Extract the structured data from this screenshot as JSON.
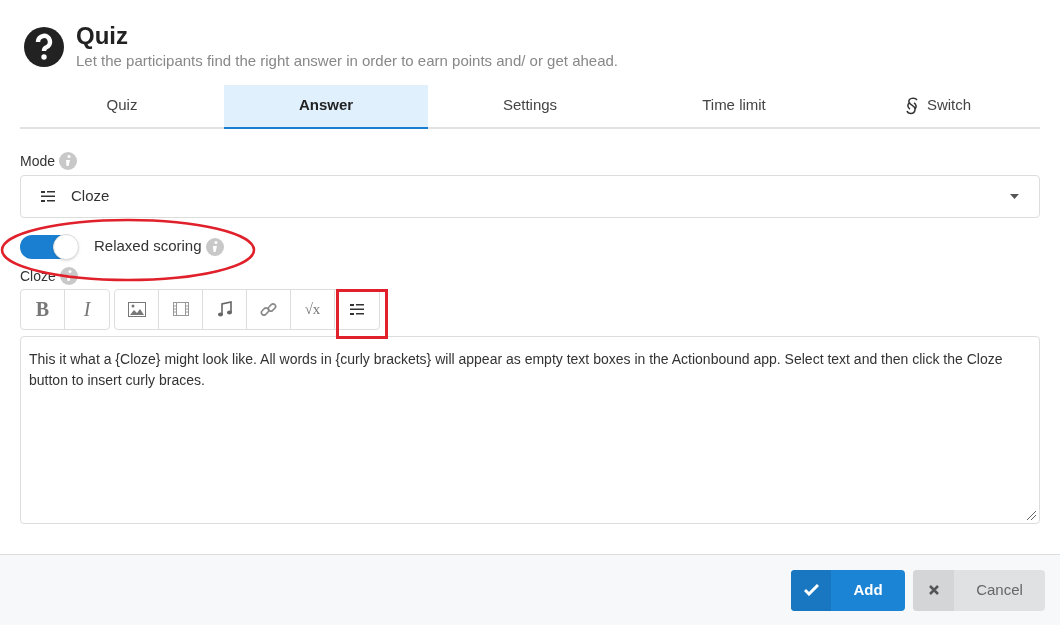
{
  "header": {
    "title": "Quiz",
    "subtitle": "Let the participants find the right answer in order to earn points and/ or get ahead."
  },
  "tabs": [
    {
      "label": "Quiz",
      "selected": false
    },
    {
      "label": "Answer",
      "selected": true
    },
    {
      "label": "Settings",
      "selected": false
    },
    {
      "label": "Time limit",
      "selected": false
    },
    {
      "label": "Switch",
      "selected": false,
      "kind": "switch"
    }
  ],
  "mode": {
    "label": "Mode",
    "value": "Cloze"
  },
  "relaxed_scoring": {
    "label": "Relaxed scoring",
    "on": true
  },
  "cloze": {
    "label": "Cloze",
    "toolbar": [
      [
        {
          "kind": "bold",
          "label": "B"
        },
        {
          "kind": "italic",
          "label": "I"
        }
      ],
      [
        {
          "kind": "image"
        },
        {
          "kind": "film"
        },
        {
          "kind": "music"
        },
        {
          "kind": "link"
        },
        {
          "kind": "formula",
          "label": "√x"
        },
        {
          "kind": "cloze"
        }
      ]
    ],
    "text": "This it what a {Cloze} might look like. All words in {curly brackets} will appear as empty text boxes in the Actionbound app. Select text and then click the Cloze button to insert curly braces."
  },
  "buttons": {
    "add": "Add",
    "cancel": "Cancel"
  }
}
